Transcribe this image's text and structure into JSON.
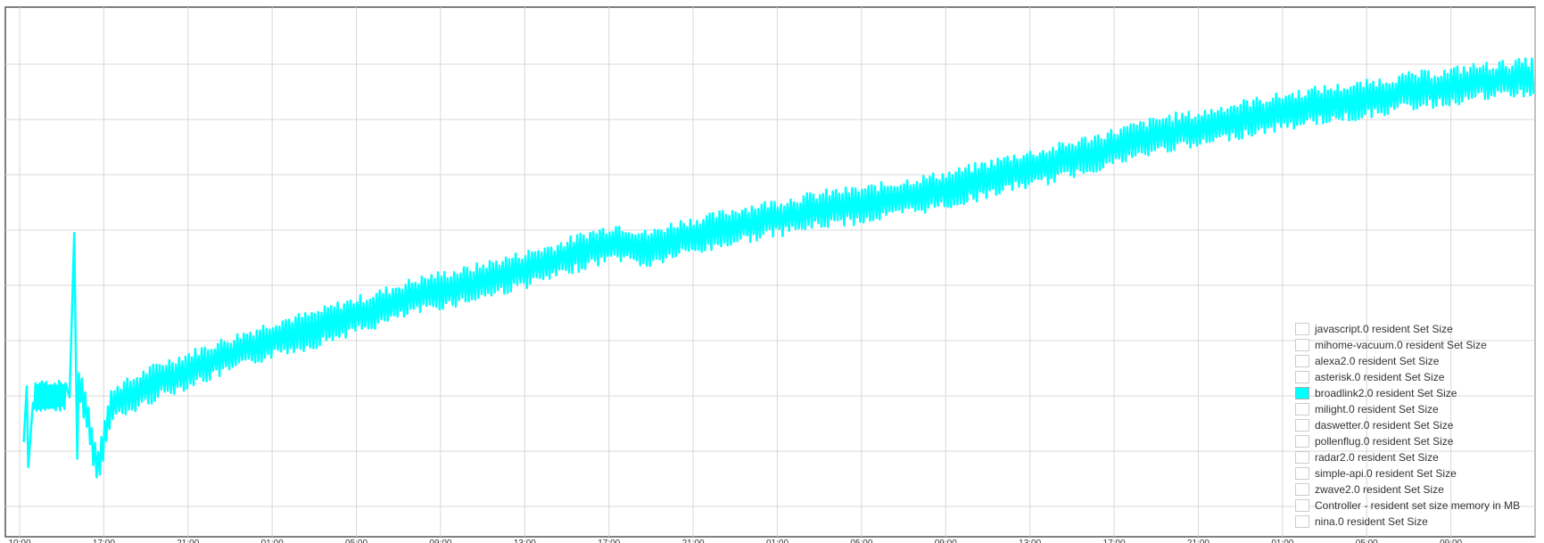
{
  "chart_data": {
    "type": "line",
    "title": "",
    "xlabel": "",
    "ylabel": "",
    "x_tick_labels": [
      "10:00",
      "17:00",
      "21:00",
      "01:00",
      "05:00",
      "09:00",
      "13:00",
      "17:00",
      "21:00",
      "01:00",
      "05:00",
      "09:00",
      "13:00",
      "17:00",
      "21:00",
      "01:00",
      "05:00",
      "09:00"
    ],
    "x_tick_labels_note_visible": false,
    "y_tick_count": 10,
    "grid": true,
    "legend_position": "bottom-right",
    "series": [
      {
        "name": "javascript.0 resident Set Size",
        "color": "",
        "visible": false,
        "values": []
      },
      {
        "name": "mihome-vacuum.0 resident Set Size",
        "color": "",
        "visible": false,
        "values": []
      },
      {
        "name": "alexa2.0 resident Set Size",
        "color": "",
        "visible": false,
        "values": []
      },
      {
        "name": "asterisk.0 resident Set Size",
        "color": "",
        "visible": false,
        "values": []
      },
      {
        "name": "broadlink2.0 resident Set Size",
        "color": "#00ffff",
        "visible": true,
        "x": [
          0.0,
          0.02,
          0.04,
          0.05,
          0.06,
          0.07,
          0.08,
          0.1,
          0.12,
          0.14,
          0.16,
          0.18,
          0.2,
          0.22,
          0.24,
          0.26,
          0.28,
          0.3,
          0.32,
          0.34,
          0.36,
          0.38,
          0.4,
          0.42,
          0.44,
          0.46,
          0.48,
          0.5,
          0.52,
          0.54,
          0.56,
          0.58,
          0.6,
          0.62,
          0.64,
          0.66,
          0.68,
          0.7,
          0.72,
          0.74,
          0.76,
          0.78,
          0.8,
          0.82,
          0.84,
          0.86,
          0.88,
          0.9,
          0.92,
          0.94,
          0.96,
          0.98,
          1.0
        ],
        "values": [
          2.9,
          5.4,
          5.2,
          5.3,
          2.5,
          4.8,
          5.0,
          5.6,
          6.0,
          6.4,
          6.8,
          7.2,
          7.4,
          7.8,
          8.1,
          8.5,
          8.8,
          9.0,
          9.3,
          9.6,
          9.9,
          10.3,
          10.6,
          10.3,
          10.7,
          10.9,
          11.2,
          11.4,
          11.6,
          11.8,
          11.9,
          12.1,
          12.3,
          12.5,
          12.8,
          13.1,
          13.3,
          13.6,
          13.9,
          14.2,
          14.5,
          14.6,
          14.9,
          15.1,
          15.3,
          15.5,
          15.6,
          15.8,
          16.0,
          16.1,
          16.3,
          16.4,
          16.5
        ]
      },
      {
        "name": "milight.0 resident Set Size",
        "color": "",
        "visible": false,
        "values": []
      },
      {
        "name": "daswetter.0 resident Set Size",
        "color": "",
        "visible": false,
        "values": []
      },
      {
        "name": "pollenflug.0 resident Set Size",
        "color": "",
        "visible": false,
        "values": []
      },
      {
        "name": "radar2.0 resident Set Size",
        "color": "",
        "visible": false,
        "values": []
      },
      {
        "name": "simple-api.0 resident Set Size",
        "color": "",
        "visible": false,
        "values": []
      },
      {
        "name": "zwave2.0 resident Set Size",
        "color": "",
        "visible": false,
        "values": []
      },
      {
        "name": "Controller - resident set size memory in MB",
        "color": "",
        "visible": false,
        "values": []
      },
      {
        "name": "nina.0 resident Set Size",
        "color": "",
        "visible": false,
        "values": []
      }
    ],
    "ylim": [
      0,
      19
    ]
  }
}
